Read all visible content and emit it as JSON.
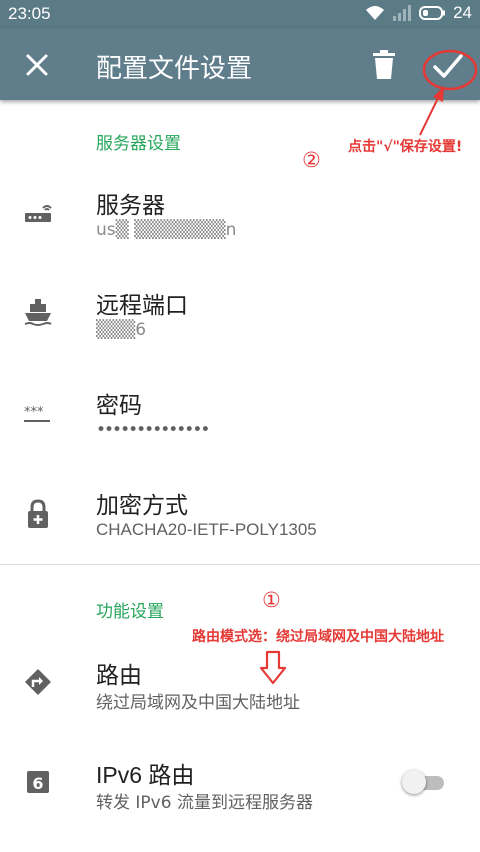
{
  "status_bar": {
    "time": "23:05",
    "battery": "24"
  },
  "toolbar": {
    "title": "配置文件设置",
    "close_icon": "close-icon",
    "delete_icon": "trash-icon",
    "save_icon": "check-icon"
  },
  "sections": {
    "server": {
      "header": "服务器设置",
      "items": [
        {
          "title": "服务器",
          "value": "us▒ ▒▒▒▒▒▒▒n",
          "icon": "router-icon"
        },
        {
          "title": "远程端口",
          "value": "▒▒▒6",
          "icon": "ship-icon"
        },
        {
          "title": "密码",
          "value": "••••••••••••••",
          "icon": "password-icon"
        },
        {
          "title": "加密方式",
          "value": "CHACHA20-IETF-POLY1305",
          "icon": "lock-icon"
        }
      ]
    },
    "feature": {
      "header": "功能设置",
      "items": [
        {
          "title": "路由",
          "value": "绕过局域网及中国大陆地址",
          "icon": "directions-icon"
        },
        {
          "title": "IPv6 路由",
          "value": "转发 IPv6 流量到远程服务器",
          "icon": "ipv6-icon",
          "toggle_on": false
        }
      ]
    }
  },
  "annotations": {
    "step2_marker": "②",
    "step2_text": "点击\"√\"保存设置!",
    "step1_marker": "①",
    "step1_text": "路由模式选：绕过局域网及中国大陆地址"
  },
  "colors": {
    "toolbar": "#607d8b",
    "status_bar": "#5a7a86",
    "category": "#26a65b",
    "annotation": "#e53935"
  }
}
